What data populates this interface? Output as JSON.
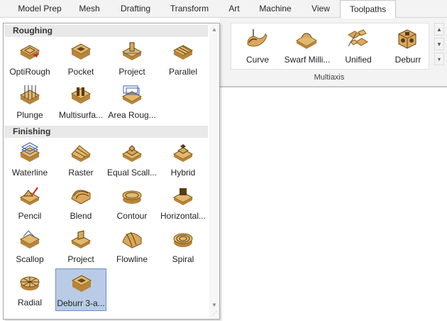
{
  "tabs": [
    {
      "label": "Model Prep"
    },
    {
      "label": "Mesh"
    },
    {
      "label": "Drafting"
    },
    {
      "label": "Transform"
    },
    {
      "label": "Art"
    },
    {
      "label": "Machine"
    },
    {
      "label": "View"
    },
    {
      "label": "Toolpaths",
      "active": true
    }
  ],
  "ribbon": {
    "group_label": "Multiaxis",
    "buttons": [
      {
        "label": "Curve",
        "icon": "curve-toolpath-icon"
      },
      {
        "label": "Swarf Milli...",
        "icon": "swarf-milling-icon"
      },
      {
        "label": "Unified",
        "icon": "unified-toolpath-icon"
      },
      {
        "label": "Deburr",
        "icon": "deburr-icon"
      }
    ]
  },
  "gallery": {
    "roughing": {
      "title": "Roughing",
      "items": [
        {
          "label": "OptiRough",
          "icon": "optirough-icon"
        },
        {
          "label": "Pocket",
          "icon": "pocket-icon"
        },
        {
          "label": "Project",
          "icon": "project-rough-icon"
        },
        {
          "label": "Parallel",
          "icon": "parallel-icon"
        },
        {
          "label": "Plunge",
          "icon": "plunge-icon"
        },
        {
          "label": "Multisurfa...",
          "icon": "multisurface-icon"
        },
        {
          "label": "Area Roug...",
          "icon": "area-roughing-icon"
        }
      ]
    },
    "finishing": {
      "title": "Finishing",
      "items": [
        {
          "label": "Waterline",
          "icon": "waterline-icon"
        },
        {
          "label": "Raster",
          "icon": "raster-icon"
        },
        {
          "label": "Equal Scall...",
          "icon": "equal-scallop-icon"
        },
        {
          "label": "Hybrid",
          "icon": "hybrid-icon"
        },
        {
          "label": "Pencil",
          "icon": "pencil-icon"
        },
        {
          "label": "Blend",
          "icon": "blend-icon"
        },
        {
          "label": "Contour",
          "icon": "contour-icon"
        },
        {
          "label": "Horizontal...",
          "icon": "horizontal-icon"
        },
        {
          "label": "Scallop",
          "icon": "scallop-icon"
        },
        {
          "label": "Project",
          "icon": "project-finish-icon"
        },
        {
          "label": "Flowline",
          "icon": "flowline-icon"
        },
        {
          "label": "Spiral",
          "icon": "spiral-icon"
        },
        {
          "label": "Radial",
          "icon": "radial-icon"
        },
        {
          "label": "Deburr 3-a...",
          "icon": "deburr-3axis-icon",
          "selected": true
        }
      ]
    }
  },
  "colors": {
    "accent": "#b9cbe6",
    "part_tan": "#d9a85a",
    "part_dark": "#a9762c"
  }
}
